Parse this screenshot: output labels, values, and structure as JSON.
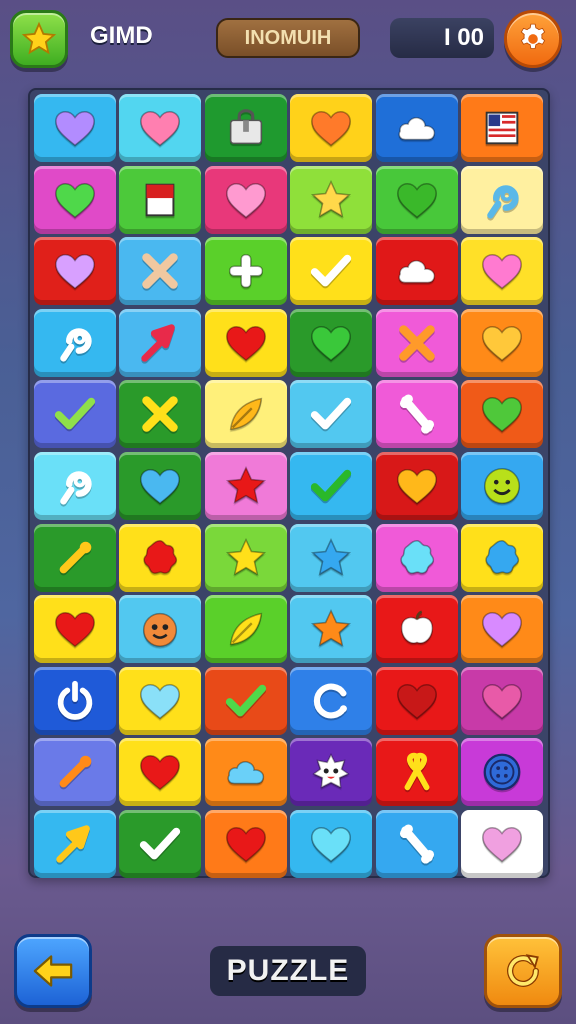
{
  "header": {
    "title": "GIMD",
    "label": "INOMUIH",
    "score": "I 00",
    "left_icon": "star-icon",
    "right_icon": "gear-icon"
  },
  "footer": {
    "mode_label": "PUZZLE",
    "back_icon": "arrow-left-icon",
    "restart_icon": "restart-icon"
  },
  "board": {
    "columns": 6,
    "rows": [
      [
        {
          "bg": "#35b8f0",
          "icon": "heart",
          "color": "#b28cff"
        },
        {
          "bg": "#52d6f0",
          "icon": "heart",
          "color": "#ff7fb0"
        },
        {
          "bg": "#1f9a2f",
          "icon": "bag",
          "color": "#e8e8e8"
        },
        {
          "bg": "#ffd21a",
          "icon": "heart",
          "color": "#ff7a2a"
        },
        {
          "bg": "#1f6fd8",
          "icon": "cloud",
          "color": "#ffffff"
        },
        {
          "bg": "#ff7a18",
          "icon": "flag",
          "color": "#ffffff"
        }
      ],
      [
        {
          "bg": "#e04ac8",
          "icon": "heart",
          "color": "#4fd84a"
        },
        {
          "bg": "#4cc93a",
          "icon": "card",
          "color": "#ffffff"
        },
        {
          "bg": "#e8387a",
          "icon": "heart",
          "color": "#ff9ad0"
        },
        {
          "bg": "#8fe03a",
          "icon": "star",
          "color": "#ffd84a"
        },
        {
          "bg": "#48c83a",
          "icon": "heart",
          "color": "#3ab82a"
        },
        {
          "bg": "#fff0a0",
          "icon": "pin",
          "color": "#5ab8e8"
        }
      ],
      [
        {
          "bg": "#e0201a",
          "icon": "heart",
          "color": "#d8a0ff"
        },
        {
          "bg": "#4ab8f0",
          "icon": "cross",
          "color": "#f0c8a0"
        },
        {
          "bg": "#5ad02a",
          "icon": "plus",
          "color": "#ffffff"
        },
        {
          "bg": "#ffe01a",
          "icon": "check",
          "color": "#ffffff"
        },
        {
          "bg": "#e01818",
          "icon": "cloud",
          "color": "#ffffff"
        },
        {
          "bg": "#ffe028",
          "icon": "heart",
          "color": "#ff7ad0"
        }
      ],
      [
        {
          "bg": "#35b8f0",
          "icon": "pin",
          "color": "#ffffff"
        },
        {
          "bg": "#4ab8f0",
          "icon": "arrow",
          "color": "#e82a4a"
        },
        {
          "bg": "#ffe01a",
          "icon": "heart",
          "color": "#e81818"
        },
        {
          "bg": "#2a9a2a",
          "icon": "heart",
          "color": "#3ac83a"
        },
        {
          "bg": "#f05ad8",
          "icon": "cross",
          "color": "#ff9a2a"
        },
        {
          "bg": "#ff8a18",
          "icon": "heart",
          "color": "#ffc83a"
        }
      ],
      [
        {
          "bg": "#5a6ae0",
          "icon": "check",
          "color": "#8fe04a"
        },
        {
          "bg": "#2a9a2a",
          "icon": "cross",
          "color": "#ffe01a"
        },
        {
          "bg": "#fff07a",
          "icon": "leaf",
          "color": "#ffb81a"
        },
        {
          "bg": "#52c8f0",
          "icon": "check",
          "color": "#ffffff"
        },
        {
          "bg": "#f05ad8",
          "icon": "bone",
          "color": "#ffffff"
        },
        {
          "bg": "#f05a18",
          "icon": "heart",
          "color": "#4fc83a"
        }
      ],
      [
        {
          "bg": "#6ae0f8",
          "icon": "pin",
          "color": "#ffffff"
        },
        {
          "bg": "#2a9a2a",
          "icon": "heart",
          "color": "#4ab8f0"
        },
        {
          "bg": "#f07ad8",
          "icon": "star",
          "color": "#e81818"
        },
        {
          "bg": "#35b8f0",
          "icon": "check",
          "color": "#2ab82a"
        },
        {
          "bg": "#d81818",
          "icon": "heart",
          "color": "#ffb81a"
        },
        {
          "bg": "#35a8f0",
          "icon": "smile",
          "color": "#b8e01a"
        }
      ],
      [
        {
          "bg": "#2a9a2a",
          "icon": "wand",
          "color": "#ffc81a"
        },
        {
          "bg": "#ffe01a",
          "icon": "splat",
          "color": "#e81818"
        },
        {
          "bg": "#7ad83a",
          "icon": "star",
          "color": "#ffe01a"
        },
        {
          "bg": "#52c8f0",
          "icon": "star",
          "color": "#35a8f0"
        },
        {
          "bg": "#f05ad8",
          "icon": "splat",
          "color": "#6ae0f8"
        },
        {
          "bg": "#ffe01a",
          "icon": "splat",
          "color": "#35a8f0"
        }
      ],
      [
        {
          "bg": "#ffe01a",
          "icon": "heart",
          "color": "#e81818"
        },
        {
          "bg": "#52c8f0",
          "icon": "face",
          "color": "#f08a3a"
        },
        {
          "bg": "#5ad02a",
          "icon": "leaf",
          "color": "#ffe01a"
        },
        {
          "bg": "#52c8f0",
          "icon": "star",
          "color": "#ff8a18"
        },
        {
          "bg": "#e81818",
          "icon": "apple",
          "color": "#ffffff"
        },
        {
          "bg": "#ff8a18",
          "icon": "heart",
          "color": "#d88aff"
        }
      ],
      [
        {
          "bg": "#1f5ad8",
          "icon": "power",
          "color": "#ffffff"
        },
        {
          "bg": "#ffe01a",
          "icon": "heart",
          "color": "#8ae0f8"
        },
        {
          "bg": "#e84a18",
          "icon": "check",
          "color": "#4fd84a"
        },
        {
          "bg": "#2f80e8",
          "icon": "ring",
          "color": "#ffffff"
        },
        {
          "bg": "#e81818",
          "icon": "heart",
          "color": "#c81818"
        },
        {
          "bg": "#c83aa8",
          "icon": "heart",
          "color": "#e85aa8"
        }
      ],
      [
        {
          "bg": "#6a7ae8",
          "icon": "wand",
          "color": "#ff8a18"
        },
        {
          "bg": "#ffe01a",
          "icon": "heart",
          "color": "#e81818"
        },
        {
          "bg": "#ff8a18",
          "icon": "cloud",
          "color": "#6ad0f8"
        },
        {
          "bg": "#6a2ab8",
          "icon": "face2",
          "color": "#ffffff"
        },
        {
          "bg": "#e81818",
          "icon": "ribbon",
          "color": "#ffe01a"
        },
        {
          "bg": "#c83ad8",
          "icon": "button",
          "color": "#2f6ad8"
        }
      ],
      [
        {
          "bg": "#35b8f0",
          "icon": "arrow",
          "color": "#ffc81a"
        },
        {
          "bg": "#2a9a2a",
          "icon": "check",
          "color": "#ffffff"
        },
        {
          "bg": "#ff7a18",
          "icon": "heart",
          "color": "#e81818"
        },
        {
          "bg": "#35b8f0",
          "icon": "heart",
          "color": "#6ae0f8"
        },
        {
          "bg": "#35a8f0",
          "icon": "bone",
          "color": "#ffffff"
        },
        {
          "bg": "#ffffff",
          "icon": "heart",
          "color": "#f0a0e0"
        }
      ]
    ]
  }
}
